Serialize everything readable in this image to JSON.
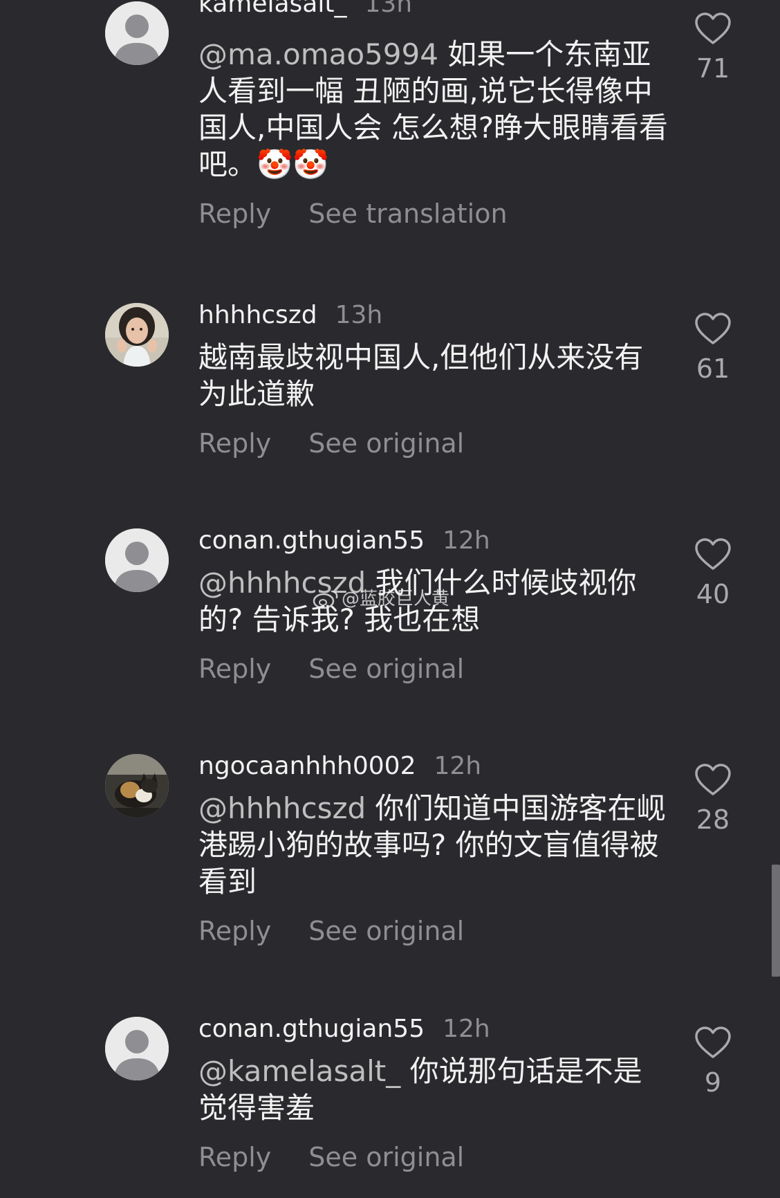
{
  "comments": [
    {
      "username": "kamelasalt_",
      "time": "13h",
      "mention": "@ma.omao5994",
      "text": " 如果一个东南亚人看到一幅 丑陋的画,说它长得像中国人,中国人会 怎么想?睁大眼睛看看吧。🤡🤡",
      "reply_label": "Reply",
      "translate_label": "See translation",
      "likes": "71",
      "avatar_icon": "default-avatar"
    },
    {
      "username": "hhhhcszd",
      "time": "13h",
      "mention": "",
      "text": "越南最歧视中国人,但他们从来没有为此道歉",
      "reply_label": "Reply",
      "translate_label": "See original",
      "likes": "61",
      "avatar_icon": "photo-avatar-girl"
    },
    {
      "username": "conan.gthugian55",
      "time": "12h",
      "mention": "@hhhhcszd",
      "text": " 我们什么时候歧视你的? 告诉我? 我也在想",
      "reply_label": "Reply",
      "translate_label": "See original",
      "likes": "40",
      "avatar_icon": "default-avatar"
    },
    {
      "username": "ngocaanhhh0002",
      "time": "12h",
      "mention": "@hhhhcszd",
      "text": " 你们知道中国游客在岘港踢小狗的故事吗? 你的文盲值得被看到",
      "reply_label": "Reply",
      "translate_label": "See original",
      "likes": "28",
      "avatar_icon": "photo-avatar-cat"
    },
    {
      "username": "conan.gthugian55",
      "time": "12h",
      "mention": "@kamelasalt_",
      "text": " 你说那句话是不是觉得害羞",
      "reply_label": "Reply",
      "translate_label": "See original",
      "likes": "9",
      "avatar_icon": "default-avatar"
    }
  ],
  "watermark": {
    "text": "@蓝胶巨人黄",
    "icon": "weibo-icon"
  }
}
